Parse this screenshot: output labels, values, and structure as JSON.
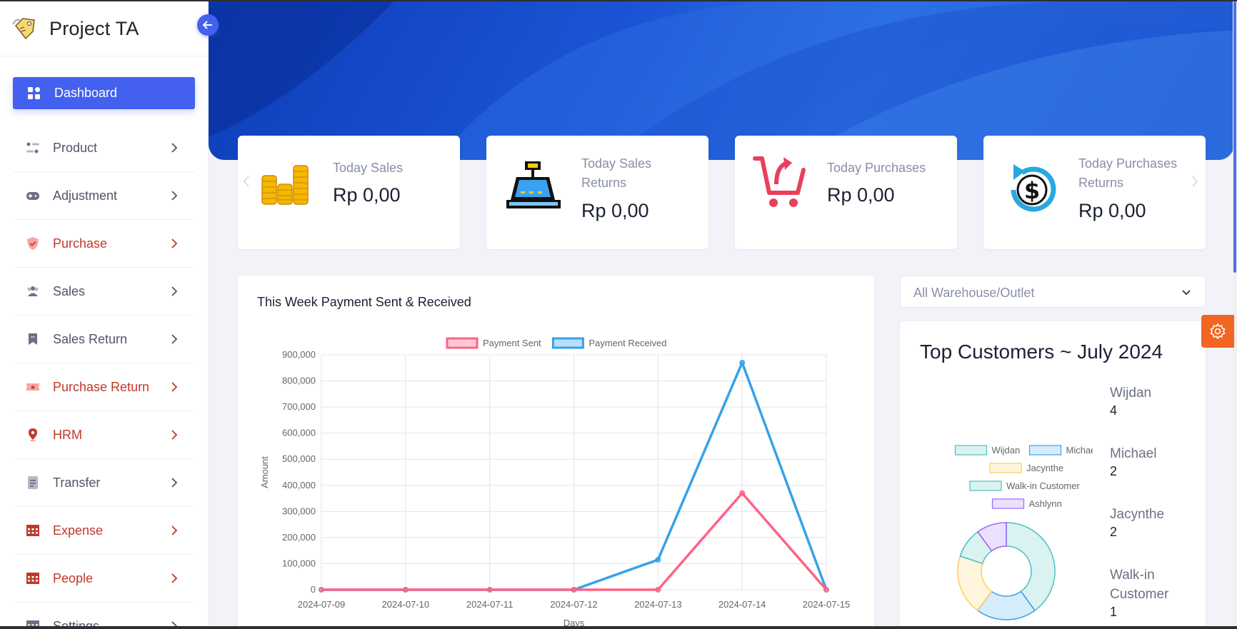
{
  "app": {
    "title": "Project TA"
  },
  "sidebar": {
    "items": [
      {
        "label": "Dashboard",
        "icon": "dashboard-icon",
        "color": "#ffffff"
      },
      {
        "label": "Product",
        "icon": "product-icon",
        "color": "#515365"
      },
      {
        "label": "Adjustment",
        "icon": "gamepad-icon",
        "color": "#515365"
      },
      {
        "label": "Purchase",
        "icon": "shield-icon",
        "color": "#c0392b"
      },
      {
        "label": "Sales",
        "icon": "users-icon",
        "color": "#515365"
      },
      {
        "label": "Sales Return",
        "icon": "bookmark-icon",
        "color": "#515365"
      },
      {
        "label": "Purchase Return",
        "icon": "ticket-icon",
        "color": "#c0392b"
      },
      {
        "label": "HRM",
        "icon": "map-pin-icon",
        "color": "#c0392b"
      },
      {
        "label": "Transfer",
        "icon": "document-icon",
        "color": "#515365"
      },
      {
        "label": "Expense",
        "icon": "calendar-icon",
        "color": "#c0392b"
      },
      {
        "label": "People",
        "icon": "calendar-icon",
        "color": "#c0392b"
      },
      {
        "label": "Settings",
        "icon": "table-icon",
        "color": "#515365"
      }
    ]
  },
  "stats": [
    {
      "label": "Today Sales",
      "value": "Rp 0,00",
      "icon": "coins-icon"
    },
    {
      "label": "Today Sales Returns",
      "value": "Rp 0,00",
      "icon": "cash-register-icon"
    },
    {
      "label": "Today Purchases",
      "value": "Rp 0,00",
      "icon": "cart-return-icon"
    },
    {
      "label": "Today Purchases Returns",
      "value": "Rp 0,00",
      "icon": "dollar-refund-icon"
    }
  ],
  "warehouse_select": {
    "value": "All Warehouse/Outlet"
  },
  "payment_chart": {
    "title": "This Week Payment Sent & Received"
  },
  "top_customers": {
    "title": "Top Customers ~ July 2024",
    "list": [
      {
        "name": "Wijdan",
        "count": "4"
      },
      {
        "name": "Michael",
        "count": "2"
      },
      {
        "name": "Jacynthe",
        "count": "2"
      },
      {
        "name": "Walk-in Customer",
        "count": "1"
      }
    ]
  },
  "chart_data": [
    {
      "type": "line",
      "title": "This Week Payment Sent & Received",
      "xlabel": "Days",
      "ylabel": "Amount",
      "x": [
        "2024-07-09",
        "2024-07-10",
        "2024-07-11",
        "2024-07-12",
        "2024-07-13",
        "2024-07-14",
        "2024-07-15"
      ],
      "ylim": [
        0,
        900000
      ],
      "yticks": [
        "0",
        "100,000",
        "200,000",
        "300,000",
        "400,000",
        "500,000",
        "600,000",
        "700,000",
        "800,000",
        "900,000"
      ],
      "grid": true,
      "legend": "top",
      "series": [
        {
          "name": "Payment Sent",
          "color": "#ff6384",
          "values": [
            0,
            0,
            0,
            0,
            0,
            370000,
            0
          ]
        },
        {
          "name": "Payment Received",
          "color": "#36a2eb",
          "values": [
            0,
            0,
            0,
            0,
            115000,
            870000,
            0
          ]
        }
      ]
    },
    {
      "type": "pie",
      "title": "",
      "legend": "top",
      "donut": true,
      "labels": [
        "Wijdan",
        "Michael",
        "Jacynthe",
        "Walk-in Customer",
        "Ashlynn"
      ],
      "values": [
        4,
        2,
        2,
        1,
        1
      ],
      "colors": [
        "#4bc0c0",
        "#36a2eb",
        "#ffcd56",
        "#4bc0c0",
        "#9966ff"
      ]
    }
  ]
}
